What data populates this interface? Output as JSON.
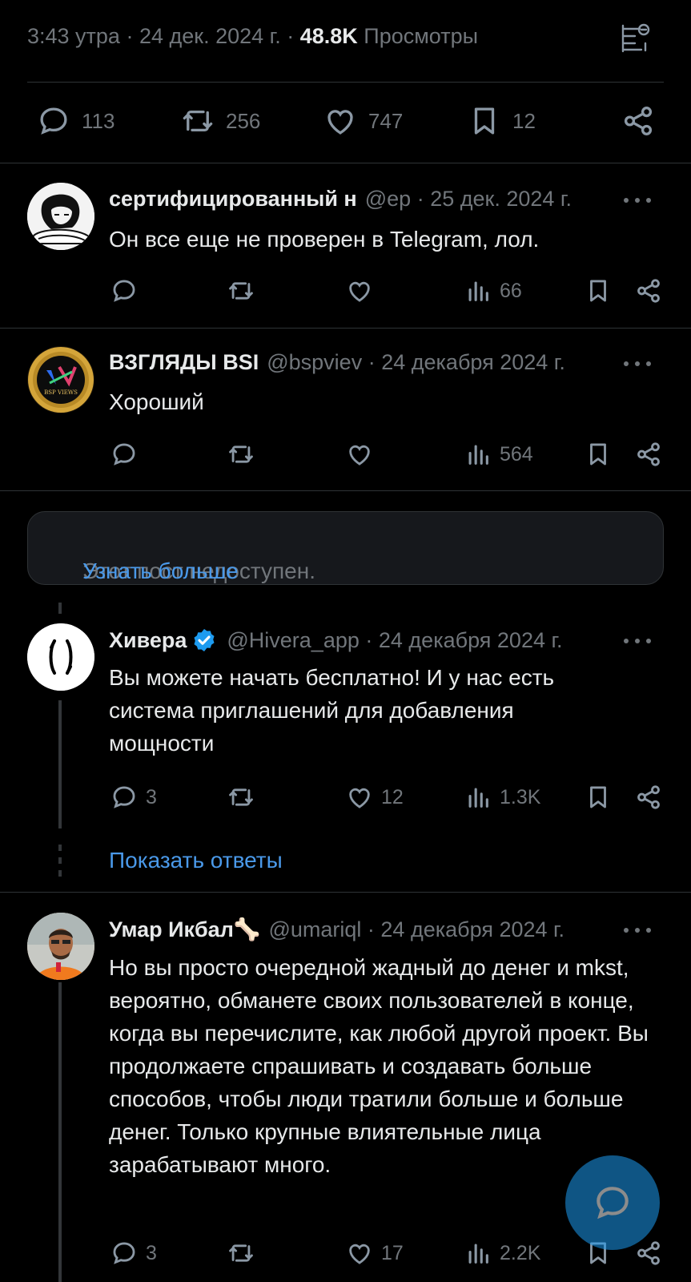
{
  "tweet": {
    "time": "3:43 утра",
    "date": "24 дек. 2024 г.",
    "views_count": "48.8K",
    "views_label": "Просмотры",
    "stats": {
      "replies": "113",
      "reposts": "256",
      "likes": "747",
      "bookmarks": "12"
    }
  },
  "replies": [
    {
      "name": "сертифицированный н",
      "handle": "@ep",
      "date": "· 25 дек. 2024 г.",
      "text": "Он все еще не проверен в Telegram, лол.",
      "views": "66"
    },
    {
      "name": "ВЗГЛЯДЫ BSI",
      "handle": "@bspviev",
      "date": "· 24 декабря 2024 г.",
      "text": "Хороший",
      "views": "564",
      "avatar_text": "BSP VIEWS"
    }
  ],
  "unavailable": {
    "text": "Этот пост недоступен.",
    "link": "Узнать больше"
  },
  "thread": [
    {
      "name": "Хивера",
      "handle": "@Hivera_app",
      "date": "· 24 декабря 2024 г.",
      "text": "Вы можете начать бесплатно! И у нас есть система приглашений для добавления мощности",
      "replies": "3",
      "likes": "12",
      "views": "1.3K"
    },
    {
      "name": "Умар Икбал🦴",
      "handle": "@umariql",
      "date": "· 24 декабря 2024 г.",
      "text": "Но вы просто очередной жадный до денег и mkst, вероятно, обманете своих пользователей в конце, когда вы перечислите, как любой другой проект. Вы продолжаете спрашивать и создавать больше способов, чтобы люди тратили больше и больше денег. Только крупные влиятельные лица зарабатывают много.",
      "replies": "3",
      "likes": "17",
      "views": "2.2K"
    }
  ],
  "show_replies": "Показать ответы",
  "colors": {
    "background": "#000000",
    "text": "#e7e9ea",
    "muted": "#71767b",
    "link": "#4a99e9",
    "accent": "#1d9bf0"
  }
}
